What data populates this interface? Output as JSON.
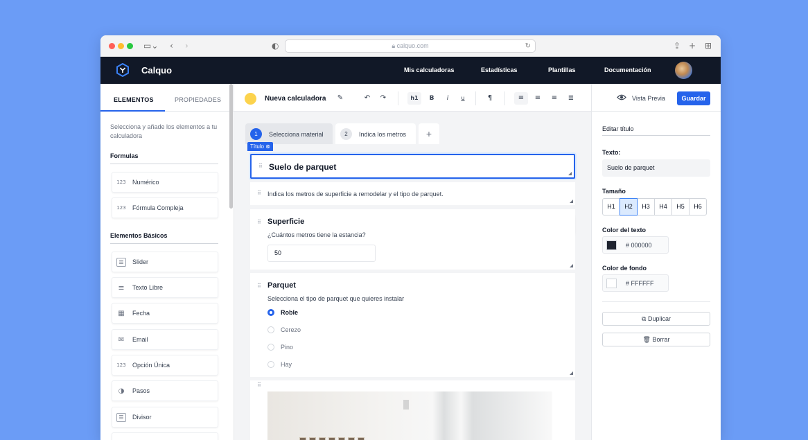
{
  "browser": {
    "url": "calquo.com",
    "lock_icon": "lock-icon"
  },
  "app": {
    "brand": "Calquo",
    "nav": [
      "Mis calculadoras",
      "Estadísticas",
      "Plantillas",
      "Documentación"
    ]
  },
  "left": {
    "tabs": [
      "ELEMENTOS",
      "PROPIEDADES"
    ],
    "description": "Selecciona y añade los elementos a tu calculadora",
    "sections": [
      {
        "title": "Formulas",
        "items": [
          {
            "label": "Numérico",
            "icon": "123"
          },
          {
            "label": "Fórmula Compleja",
            "icon": "123"
          }
        ]
      },
      {
        "title": "Elementos Básicos",
        "items": [
          {
            "label": "Slider",
            "icon": "☰"
          },
          {
            "label": "Texto Libre",
            "icon": "≡"
          },
          {
            "label": "Fecha",
            "icon": "▦"
          },
          {
            "label": "Email",
            "icon": "✉"
          },
          {
            "label": "Opción Única",
            "icon": "123"
          },
          {
            "label": "Pasos",
            "icon": "◑"
          },
          {
            "label": "Divisor",
            "icon": "☰"
          }
        ]
      }
    ]
  },
  "center": {
    "calc_title": "Nueva calculadora",
    "toolbar": {
      "heading": "h1",
      "bold": "B",
      "italic": "i",
      "underline": "u"
    },
    "steps": [
      {
        "num": "1",
        "label": "Selecciona material"
      },
      {
        "num": "2",
        "label": "Indica los metros"
      }
    ],
    "add_step": "+",
    "title_chip": "Título ⊗",
    "blocks": {
      "title_text": "Suelo de parquet",
      "intro": "Indica los metros de superficie a remodelar y el tipo de parquet.",
      "superficie": {
        "title": "Superficie",
        "question": "¿Cuántos metros tiene la estancia?",
        "value": "50"
      },
      "parquet": {
        "title": "Parquet",
        "question": "Selecciona el tipo de parquet que quieres instalar",
        "options": [
          "Roble",
          "Cerezo",
          "Pino",
          "Hay"
        ],
        "selected": 0
      }
    }
  },
  "right": {
    "preview": "Vista Previa",
    "save": "Guardar",
    "section": "Editar título",
    "text_label": "Texto:",
    "text_value": "Suelo de parquet",
    "size_label": "Tamaño",
    "sizes": [
      "H1",
      "H2",
      "H3",
      "H4",
      "H5",
      "H6"
    ],
    "selected_size": 1,
    "text_color_label": "Color del texto",
    "text_color": "# 000000",
    "text_color_swatch": "#1f2430",
    "bg_color_label": "Color de fondo",
    "bg_color": "# FFFFFF",
    "bg_color_swatch": "#ffffff",
    "duplicate": "Duplicar",
    "delete": "Borrar"
  },
  "colors": {
    "accent": "#2563eb",
    "nav_bg": "#111827",
    "background": "#6b9cf6"
  }
}
